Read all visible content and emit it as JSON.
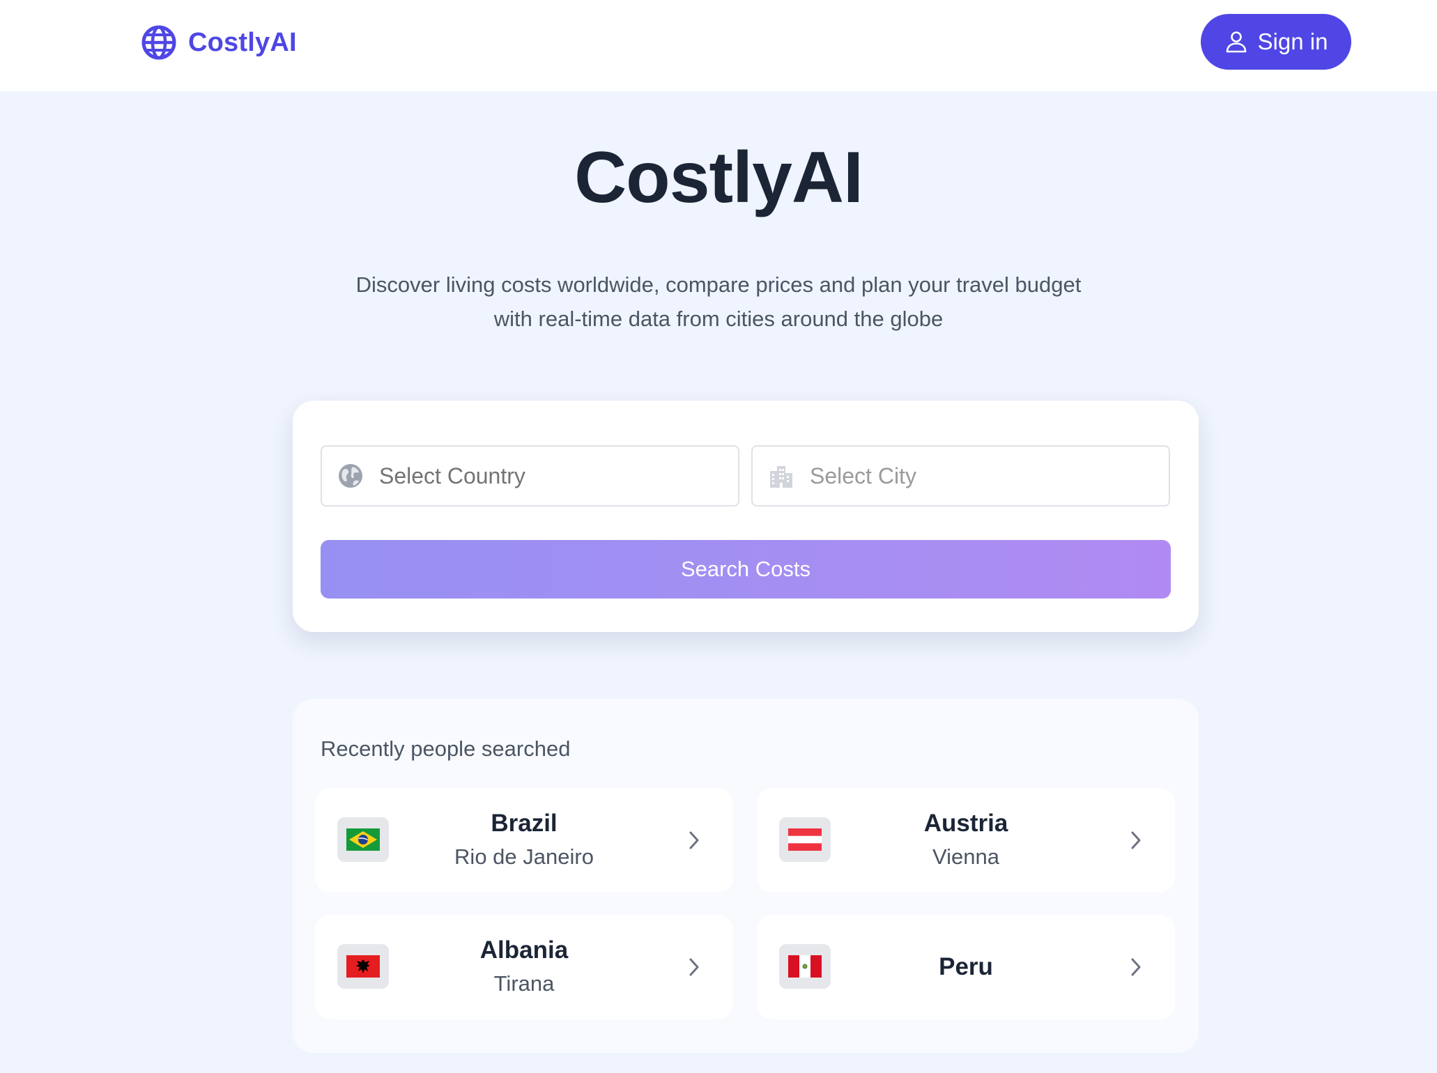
{
  "header": {
    "brand_name": "CostlyAI",
    "brand_icon": "globe-icon",
    "signin_label": "Sign in",
    "signin_icon": "user-icon"
  },
  "hero": {
    "title": "CostlyAI",
    "subtitle_line1": "Discover living costs worldwide, compare prices and plan your travel budget",
    "subtitle_line2": "with real-time data from cities around the globe"
  },
  "search": {
    "country_placeholder": "Select Country",
    "country_icon": "earth-icon",
    "city_placeholder": "Select City",
    "city_icon": "city-buildings-icon",
    "button_label": "Search Costs"
  },
  "recent": {
    "title": "Recently people searched",
    "items": [
      {
        "country": "Brazil",
        "city": "Rio de Janeiro",
        "flag": "brazil-flag-icon"
      },
      {
        "country": "Austria",
        "city": "Vienna",
        "flag": "austria-flag-icon"
      },
      {
        "country": "Albania",
        "city": "Tirana",
        "flag": "albania-flag-icon"
      },
      {
        "country": "Peru",
        "city": "",
        "flag": "peru-flag-icon"
      }
    ]
  },
  "colors": {
    "accent": "#4f46e5",
    "page_background": "#eff4fe",
    "heading": "#1b2536",
    "body_text": "#4b5563",
    "button_gradient_start": "#9790f2",
    "button_gradient_end": "#b08af2"
  }
}
